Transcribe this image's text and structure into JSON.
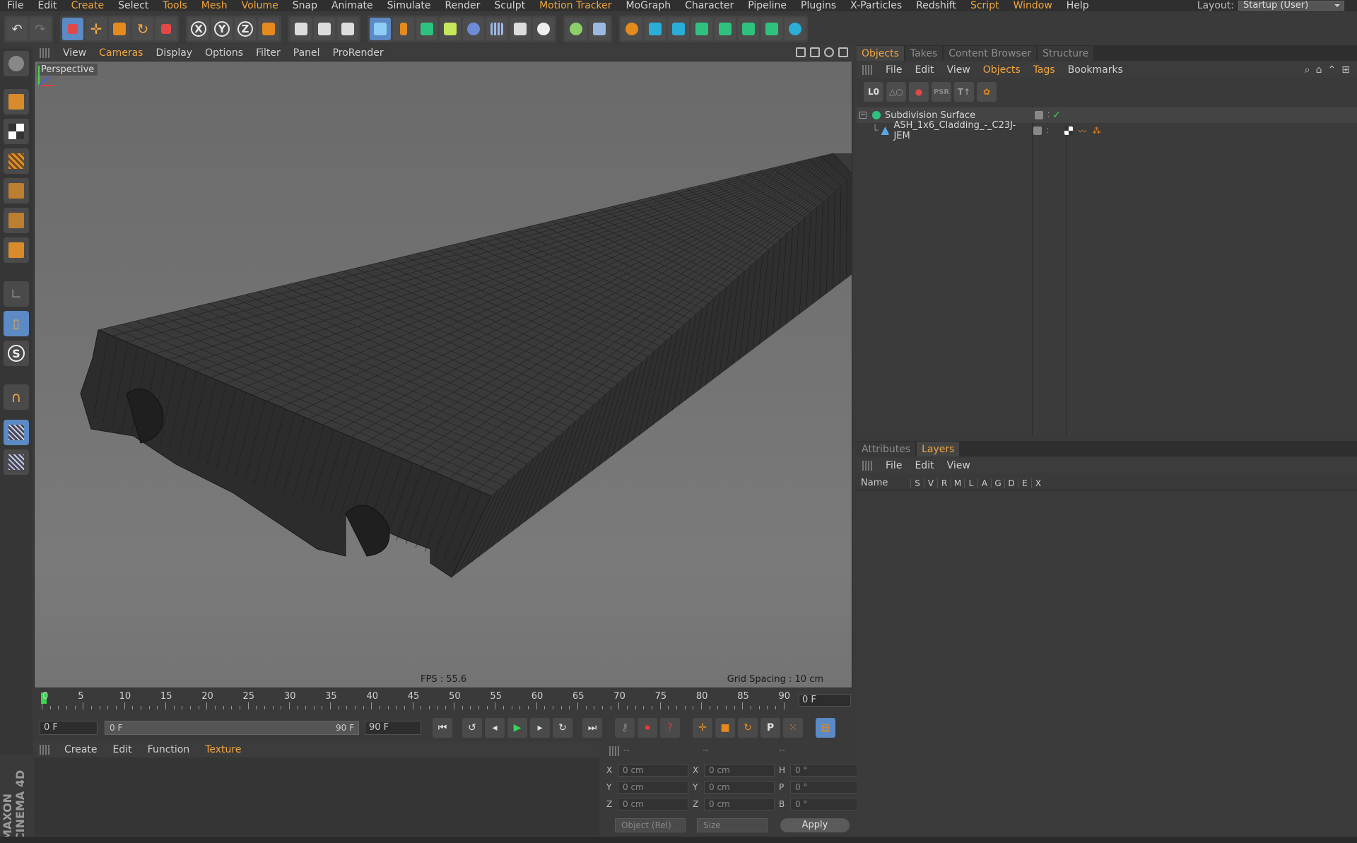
{
  "menubar": {
    "items": [
      {
        "label": "File",
        "hl": false
      },
      {
        "label": "Edit",
        "hl": false
      },
      {
        "label": "Create",
        "hl": true
      },
      {
        "label": "Select",
        "hl": false
      },
      {
        "label": "Tools",
        "hl": true
      },
      {
        "label": "Mesh",
        "hl": true
      },
      {
        "label": "Volume",
        "hl": true
      },
      {
        "label": "Snap",
        "hl": false
      },
      {
        "label": "Animate",
        "hl": false
      },
      {
        "label": "Simulate",
        "hl": false
      },
      {
        "label": "Render",
        "hl": false
      },
      {
        "label": "Sculpt",
        "hl": false
      },
      {
        "label": "Motion Tracker",
        "hl": true
      },
      {
        "label": "MoGraph",
        "hl": false
      },
      {
        "label": "Character",
        "hl": false
      },
      {
        "label": "Pipeline",
        "hl": false
      },
      {
        "label": "Plugins",
        "hl": false
      },
      {
        "label": "X-Particles",
        "hl": false
      },
      {
        "label": "Redshift",
        "hl": false
      },
      {
        "label": "Script",
        "hl": true
      },
      {
        "label": "Window",
        "hl": true
      },
      {
        "label": "Help",
        "hl": false
      }
    ],
    "layout_label": "Layout:",
    "layout_value": "Startup (User)"
  },
  "toolbar": {
    "axis_x": "X",
    "axis_y": "Y",
    "axis_z": "Z"
  },
  "viewport": {
    "menus": [
      {
        "label": "View",
        "hl": false
      },
      {
        "label": "Cameras",
        "hl": true
      },
      {
        "label": "Display",
        "hl": false
      },
      {
        "label": "Options",
        "hl": false
      },
      {
        "label": "Filter",
        "hl": false
      },
      {
        "label": "Panel",
        "hl": false
      },
      {
        "label": "ProRender",
        "hl": false
      }
    ],
    "camera_label": "Perspective",
    "fps": "FPS : 55.6",
    "grid_spacing": "Grid Spacing : 10 cm"
  },
  "timeline": {
    "ticks": [
      "0",
      "5",
      "10",
      "15",
      "20",
      "25",
      "30",
      "35",
      "40",
      "45",
      "50",
      "55",
      "60",
      "65",
      "70",
      "75",
      "80",
      "85",
      "90"
    ],
    "current_frame": "0 F"
  },
  "transport": {
    "start_field": "0 F",
    "range_start": "0 F",
    "range_end": "90 F",
    "end_field": "90 F"
  },
  "material": {
    "menus": [
      {
        "label": "Create",
        "hl": false
      },
      {
        "label": "Edit",
        "hl": false
      },
      {
        "label": "Function",
        "hl": false
      },
      {
        "label": "Texture",
        "hl": true
      }
    ]
  },
  "coords": {
    "dash1": "--",
    "dash2": "--",
    "dash3": "--",
    "pos_x": "0 cm",
    "pos_y": "0 cm",
    "pos_z": "0 cm",
    "size_x": "0 cm",
    "size_y": "0 cm",
    "size_z": "0 cm",
    "rot_h": "0 °",
    "rot_p": "0 °",
    "rot_b": "0 °",
    "mode": "Object (Rel)",
    "size_mode": "Size",
    "apply": "Apply"
  },
  "objects_panel": {
    "tabs": [
      {
        "label": "Objects",
        "active": true
      },
      {
        "label": "Takes",
        "active": false
      },
      {
        "label": "Content Browser",
        "active": false
      },
      {
        "label": "Structure",
        "active": false
      }
    ],
    "menus": [
      {
        "label": "File",
        "hl": false
      },
      {
        "label": "Edit",
        "hl": false
      },
      {
        "label": "View",
        "hl": false
      },
      {
        "label": "Objects",
        "hl": true
      },
      {
        "label": "Tags",
        "hl": true
      },
      {
        "label": "Bookmarks",
        "hl": false
      }
    ],
    "objects": [
      {
        "name": "Subdivision Surface",
        "depth": 0
      },
      {
        "name": "ASH_1x6_Cladding_-_C23J-JEM",
        "depth": 1
      }
    ]
  },
  "layers_panel": {
    "tabs": [
      {
        "label": "Attributes",
        "active": false
      },
      {
        "label": "Layers",
        "active": true
      }
    ],
    "menus": [
      "File",
      "Edit",
      "View"
    ],
    "columns": [
      "S",
      "V",
      "R",
      "M",
      "L",
      "A",
      "G",
      "D",
      "E",
      "X"
    ],
    "name_col": "Name"
  },
  "brand": {
    "text": "MAXON CINEMA 4D"
  },
  "colors": {
    "accent": "#f0a640",
    "play": "#39d15a"
  }
}
